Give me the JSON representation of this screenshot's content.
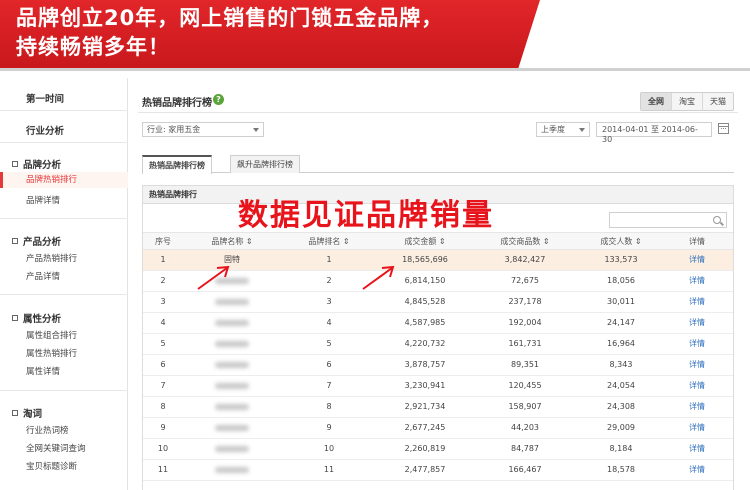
{
  "banner": {
    "line1": "品牌创立20年，网上销售的门锁五金品牌，",
    "line2": "持续畅销多年！"
  },
  "sidebar": {
    "top_items": [
      "第一时间",
      "行业分析"
    ],
    "groups": [
      {
        "title": "品牌分析",
        "items": [
          "品牌热销排行",
          "品牌详情"
        ]
      },
      {
        "title": "产品分析",
        "items": [
          "产品热销排行",
          "产品详情"
        ]
      },
      {
        "title": "属性分析",
        "items": [
          "属性组合排行",
          "属性热销排行",
          "属性详情"
        ]
      },
      {
        "title": "淘词",
        "items": [
          "行业热词榜",
          "全网关键词查询",
          "宝贝标题诊断"
        ]
      }
    ]
  },
  "header": {
    "title": "热销品牌排行榜",
    "help": "?",
    "channels": [
      "全网",
      "淘宝",
      "天猫"
    ]
  },
  "filters": {
    "industry": "行业: 家用五金",
    "period": "上季度",
    "date_range": "2014-04-01 至 2014-06-30"
  },
  "tabs": [
    "热销品牌排行榜",
    "飙升品牌排行榜"
  ],
  "panel": {
    "title": "热销品牌排行"
  },
  "overlay": "数据见证品牌销量",
  "table": {
    "columns": [
      "序号",
      "品牌名称 ⇕",
      "品牌排名 ⇕",
      "成交金额 ⇕",
      "成交商品数 ⇕",
      "成交人数 ⇕",
      "详情"
    ],
    "rows": [
      {
        "idx": "1",
        "brand": "固特",
        "rank": "1",
        "amount": "18,565,696",
        "goods": "3,842,427",
        "buyers": "133,573",
        "detail": "详情"
      },
      {
        "idx": "2",
        "brand": "",
        "rank": "2",
        "amount": "6,814,150",
        "goods": "72,675",
        "buyers": "18,056",
        "detail": "详情"
      },
      {
        "idx": "3",
        "brand": "",
        "rank": "3",
        "amount": "4,845,528",
        "goods": "237,178",
        "buyers": "30,011",
        "detail": "详情"
      },
      {
        "idx": "4",
        "brand": "",
        "rank": "4",
        "amount": "4,587,985",
        "goods": "192,004",
        "buyers": "24,147",
        "detail": "详情"
      },
      {
        "idx": "5",
        "brand": "",
        "rank": "5",
        "amount": "4,220,732",
        "goods": "161,731",
        "buyers": "16,964",
        "detail": "详情"
      },
      {
        "idx": "6",
        "brand": "",
        "rank": "6",
        "amount": "3,878,757",
        "goods": "89,351",
        "buyers": "8,343",
        "detail": "详情"
      },
      {
        "idx": "7",
        "brand": "",
        "rank": "7",
        "amount": "3,230,941",
        "goods": "120,455",
        "buyers": "24,054",
        "detail": "详情"
      },
      {
        "idx": "8",
        "brand": "",
        "rank": "8",
        "amount": "2,921,734",
        "goods": "158,907",
        "buyers": "24,308",
        "detail": "详情"
      },
      {
        "idx": "9",
        "brand": "",
        "rank": "9",
        "amount": "2,677,245",
        "goods": "44,203",
        "buyers": "29,009",
        "detail": "详情"
      },
      {
        "idx": "10",
        "brand": "",
        "rank": "10",
        "amount": "2,260,819",
        "goods": "84,787",
        "buyers": "8,184",
        "detail": "详情"
      },
      {
        "idx": "11",
        "brand": "",
        "rank": "11",
        "amount": "2,477,857",
        "goods": "166,467",
        "buyers": "18,578",
        "detail": "详情"
      }
    ]
  },
  "colors": {
    "accent": "#e4393c",
    "banner": "#d81e22",
    "link": "#2a6ebd",
    "highlight_row": "#fdeee2"
  }
}
